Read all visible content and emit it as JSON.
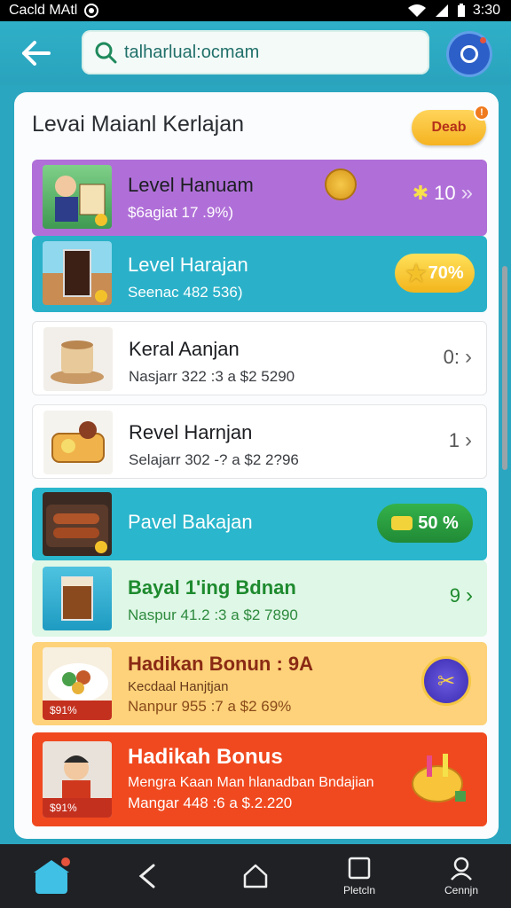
{
  "status_bar": {
    "carrier": "Cacld MAtl",
    "time": "3:30"
  },
  "search": {
    "value": "talharlual:ocmam"
  },
  "card": {
    "title": "Levai Maianl Kerlajan",
    "badge_label": "Deab"
  },
  "rows": [
    {
      "title": "Level Hanuam",
      "subtitle": "$6agiat 17 .9%)",
      "right_text": "10",
      "bg": "#b06fd8"
    },
    {
      "title": "Level Harajan",
      "subtitle": "Seenac 482 536)",
      "right_text": "70%",
      "bg": "#2ab1c9"
    },
    {
      "title": "Keral Aanjan",
      "subtitle": "Nasjarr 322 :3 a $2 5290",
      "right_text": "0:",
      "bg": "#ffffff"
    },
    {
      "title": "Revel Harnjan",
      "subtitle": "Selajarr 302 -? a $2 2?96",
      "right_text": "1",
      "bg": "#ffffff"
    },
    {
      "title": "Pavel Bakajan",
      "subtitle": "",
      "right_text": "50 %",
      "bg": "#2ab6cc"
    },
    {
      "title": "Bayal 1'ing Bdnan",
      "subtitle": "Naspur 41.2 :3 a $2 7890",
      "right_text": "9",
      "bg": "#dff7e6"
    },
    {
      "title": "Hadikan Bonun : 9A",
      "subtitle2": "Kecdaal Hanjtjan",
      "subtitle": "Nanpur 955 :7 a $2 69%",
      "thumb_badge": "$91%",
      "bg": "#fdd27a"
    },
    {
      "title": "Hadikah Bonus",
      "subtitle2": "Mengra Kaan Man hlanadban Bndajian",
      "subtitle": "Mangar 448 :6 a $.2.220",
      "thumb_badge": "$91%",
      "bg": "#f0491f"
    }
  ],
  "nav": {
    "item3_label": "Pletcln",
    "item4_label": "Cennjn"
  }
}
